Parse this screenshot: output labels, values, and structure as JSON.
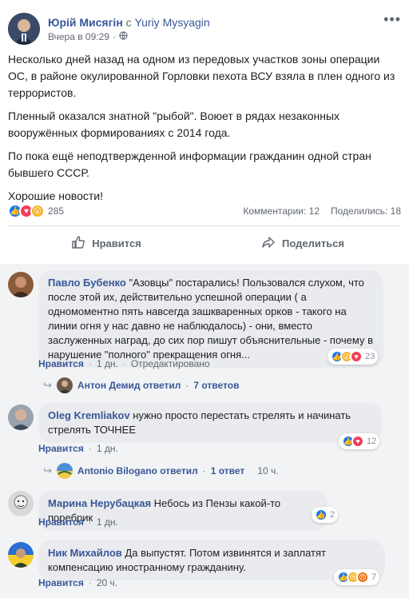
{
  "post": {
    "author": "Юрій Мисягін",
    "connector": "с",
    "co_author": "Yuriy Mysyagin",
    "time": "Вчера в 09:29",
    "separator": "·",
    "more": "•••",
    "paragraphs": [
      "Несколько дней назад на одном из передовых участков зоны операции ОС, в районе окулированной Горловки пехота ВСУ взяла в плен одного из террористов.",
      "Пленный оказался знатной \"рыбой\". Воюет в рядах незаконных вооружённых формированиях с 2014 года.",
      "По пока ещё неподтвержденной информации гражданин одной стран бывшего СССР.",
      "Хорошие новости!"
    ],
    "reactions_count": "285",
    "comments_label": "Комментарии: 12",
    "shares_label": "Поделились: 18",
    "like_label": "Нравится",
    "share_label": "Поделиться"
  },
  "comments": [
    {
      "name": "Павло Бубенко",
      "text": "\"Азовцы\" постарались! Пользовался слухом, что после этой их, действительно успешной операции ( а одномоментно пять навсегда зашкваренных орков - такого на линии огня у нас давно не наблюдалось) - они, вместо заслуженных наград, до сих пор пишут объяснительные - почему в нарушение \"полного\" прекращения огня...",
      "reactions": "23",
      "like": "Нравится",
      "time": "1 дн.",
      "extra": "Отредактировано",
      "reply_author": "Антон Демид ответил",
      "reply_count": "7 ответов"
    },
    {
      "name": "Oleg Kremliakov",
      "text": "нужно просто перестать стрелять и начинать стрелять ТОЧНЕЕ",
      "reactions": "12",
      "like": "Нравится",
      "time": "1 дн.",
      "reply_author": "Antonio Bilogano ответил",
      "reply_count": "1 ответ",
      "reply_time": "10 ч."
    },
    {
      "name": "Марина Нерубацкая",
      "text": "Небось из Пензы какой-то поребрик",
      "reactions": "2",
      "like": "Нравится",
      "time": "1 дн."
    },
    {
      "name": "Ник Михайлов",
      "text": "Да выпустят. Потом извинятся и заплатят компенсацию иностранному гражданину.",
      "reactions": "7",
      "like": "Нравится",
      "time": "20 ч."
    }
  ],
  "icons": {
    "globe": "globe-icon",
    "like": "thumbs-up-icon",
    "share": "share-arrow-icon",
    "reply": "reply-arrow-icon"
  },
  "colors": {
    "link": "#385898",
    "like_reaction": "#1877f2",
    "love_reaction": "#f33e58",
    "wow_reaction": "#f7b125"
  }
}
